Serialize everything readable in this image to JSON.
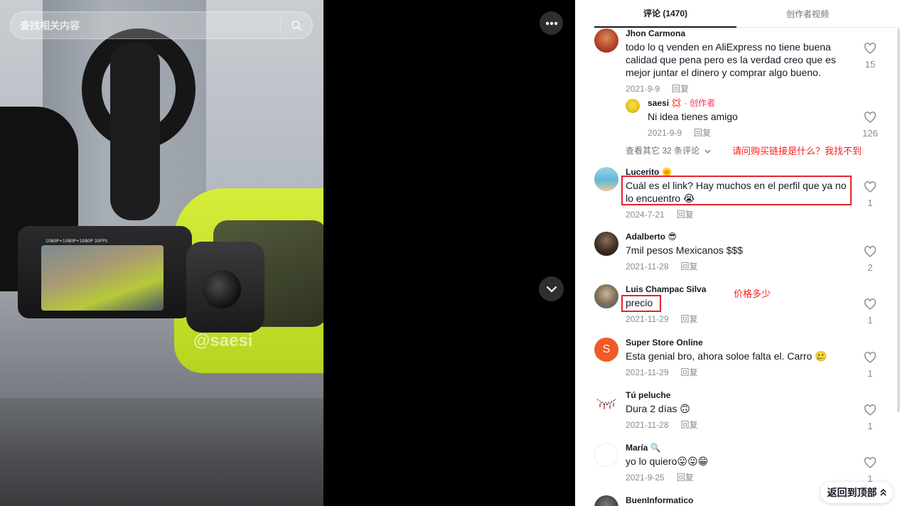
{
  "search": {
    "placeholder": "查找相关内容"
  },
  "video": {
    "watermark": "@saesi",
    "camera_label": "1080P+1080P+1080P 30FPS"
  },
  "tabs": [
    {
      "label": "评论 (1470)",
      "active": true
    },
    {
      "label": "创作者视频",
      "active": false
    }
  ],
  "comments": [
    {
      "user": "Jhon Carmona",
      "text": "todo lo q venden en AliExpress no tiene buena calidad que pena pero es la verdad creo que es mejor juntar el dinero y comprar algo bueno.",
      "date": "2021-9-9",
      "reply_label": "回复",
      "likes": "15",
      "reply": {
        "user": "saesi 💢",
        "creator_tag": "· 创作者",
        "text": "Ni idea tienes amigo",
        "date": "2021-9-9",
        "reply_label": "回复",
        "likes": "126"
      },
      "view_more": "查看其它 32 条评论"
    },
    {
      "user": "Lucerito 🌞",
      "text": "Cuál es el link? Hay muchos en el perfil que ya no lo encuentro 😭",
      "date": "2024-7-21",
      "reply_label": "回复",
      "likes": "1"
    },
    {
      "user": "Adalberto 😎",
      "text": "7mil pesos Mexicanos $$$",
      "date": "2021-11-28",
      "reply_label": "回复",
      "likes": "2"
    },
    {
      "user": "Luis Champac Silva",
      "text": "precio",
      "date": "2021-11-29",
      "reply_label": "回复",
      "likes": "1"
    },
    {
      "user": "Super Store Online",
      "avatar_letter": "S",
      "text": "Esta genial bro, ahora soloe falta el. Carro 🥲",
      "date": "2021-11-29",
      "reply_label": "回复",
      "likes": "1"
    },
    {
      "user": "Tú peluche",
      "text": "Dura 2 días 🙃",
      "date": "2021-11-28",
      "reply_label": "回复",
      "likes": "1"
    },
    {
      "user": "María 🔍",
      "text": "yo lo quiero😛😛😁",
      "date": "2021-9-25",
      "reply_label": "回复",
      "likes": "1"
    },
    {
      "user": "BuenInformatico"
    }
  ],
  "annotations": {
    "note_link": "请问购买链接是什么？我找不到",
    "note_price": "价格多少"
  },
  "back_to_top": "返回到顶部"
}
